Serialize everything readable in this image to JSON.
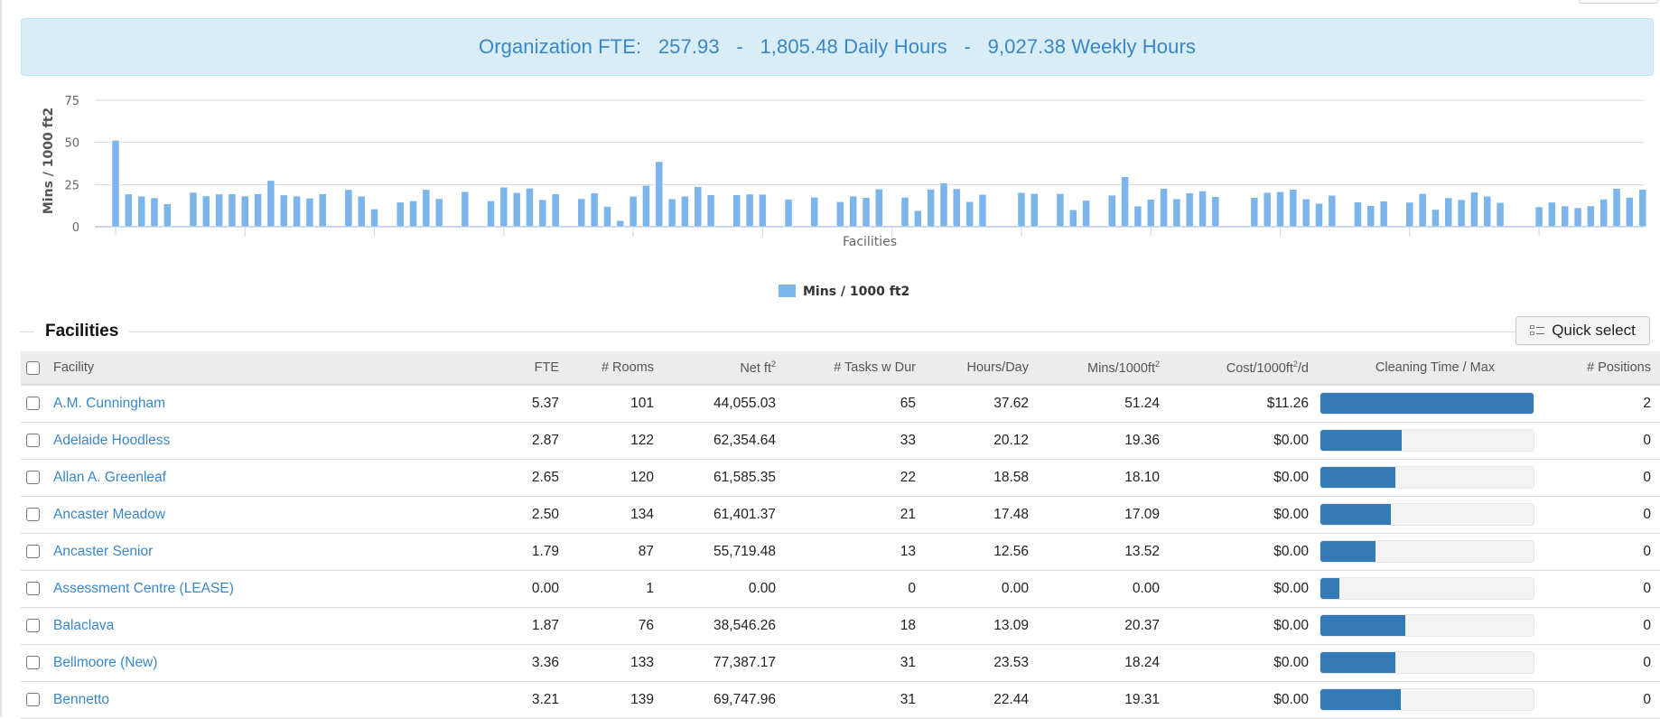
{
  "banner": {
    "label": "Organization FTE:",
    "fte": "257.93",
    "sep1": "-",
    "daily": "1,805.48 Daily Hours",
    "sep2": "-",
    "weekly": "9,027.38 Weekly Hours"
  },
  "chart_data": {
    "type": "bar",
    "title": "",
    "xlabel": "Facilities",
    "ylabel": "Mins / 1000 ft2",
    "ylim": [
      0,
      75
    ],
    "yticks": [
      0,
      25,
      50,
      75
    ],
    "grid": true,
    "legend": {
      "position": "bottom-center",
      "entries": [
        "Mins / 1000 ft2"
      ]
    },
    "series": [
      {
        "name": "Mins / 1000 ft2",
        "color": "#7cb5ec",
        "values": [
          51.24,
          19.36,
          18.1,
          17.09,
          13.52,
          0,
          20.37,
          18.24,
          19.31,
          19.4,
          18.2,
          19.5,
          27.4,
          18.8,
          18.1,
          16.9,
          19.5,
          0,
          22,
          18.1,
          10.5,
          0,
          14.5,
          15.3,
          22,
          16.6,
          0,
          20.7,
          0,
          15.3,
          23.4,
          20.2,
          22.8,
          16,
          19.4,
          0,
          16.6,
          20,
          12,
          3.6,
          18,
          24.5,
          38.6,
          16.5,
          18,
          23.8,
          18.9,
          0,
          18.9,
          19.3,
          19.2,
          0,
          16.2,
          0,
          17.5,
          0,
          14.8,
          18.1,
          17.3,
          22.3,
          0,
          17.4,
          9.5,
          22.2,
          25.9,
          22.5,
          14.9,
          19.1,
          0,
          0,
          20.2,
          19.6,
          0,
          19.6,
          10,
          15.6,
          0,
          18.7,
          29.6,
          12.2,
          16.2,
          22.7,
          16.5,
          20,
          21.2,
          17.8,
          0,
          0,
          17.3,
          20.3,
          20.8,
          22.1,
          16.5,
          13.8,
          18.6,
          0,
          14.6,
          12.5,
          15.2,
          0,
          14.5,
          19.6,
          10.2,
          17.1,
          16,
          20.5,
          18,
          14.3,
          0,
          0,
          11.8,
          14.5,
          12.3,
          11.2,
          12.3,
          16.3,
          22.7,
          17.4,
          22.1
        ]
      }
    ]
  },
  "section": {
    "title": "Facilities",
    "quick_select": "Quick select"
  },
  "table": {
    "columns": {
      "facility": "Facility",
      "fte": "FTE",
      "rooms": "# Rooms",
      "net": "Net ft",
      "tasks": "# Tasks w Dur",
      "hours": "Hours/Day",
      "mins": "Mins/1000ft",
      "cost_a": "Cost/1000ft",
      "cost_b": "/d",
      "ctime": "Cleaning Time / Max",
      "positions": "# Positions",
      "sup": "2"
    },
    "rows": [
      {
        "facility": "A.M. Cunningham",
        "fte": "5.37",
        "rooms": "101",
        "net": "44,055.03",
        "tasks": "65",
        "hours": "37.62",
        "mins": "51.24",
        "cost": "$11.26",
        "ctime": 1.0,
        "positions": "2"
      },
      {
        "facility": "Adelaide Hoodless",
        "fte": "2.87",
        "rooms": "122",
        "net": "62,354.64",
        "tasks": "33",
        "hours": "20.12",
        "mins": "19.36",
        "cost": "$0.00",
        "ctime": 0.38,
        "positions": "0"
      },
      {
        "facility": "Allan A. Greenleaf",
        "fte": "2.65",
        "rooms": "120",
        "net": "61,585.35",
        "tasks": "22",
        "hours": "18.58",
        "mins": "18.10",
        "cost": "$0.00",
        "ctime": 0.35,
        "positions": "0"
      },
      {
        "facility": "Ancaster Meadow",
        "fte": "2.50",
        "rooms": "134",
        "net": "61,401.37",
        "tasks": "21",
        "hours": "17.48",
        "mins": "17.09",
        "cost": "$0.00",
        "ctime": 0.33,
        "positions": "0"
      },
      {
        "facility": "Ancaster Senior",
        "fte": "1.79",
        "rooms": "87",
        "net": "55,719.48",
        "tasks": "13",
        "hours": "12.56",
        "mins": "13.52",
        "cost": "$0.00",
        "ctime": 0.26,
        "positions": "0"
      },
      {
        "facility": "Assessment Centre (LEASE)",
        "fte": "0.00",
        "rooms": "1",
        "net": "0.00",
        "tasks": "0",
        "hours": "0.00",
        "mins": "0.00",
        "cost": "$0.00",
        "ctime": 0.09,
        "positions": "0"
      },
      {
        "facility": "Balaclava",
        "fte": "1.87",
        "rooms": "76",
        "net": "38,546.26",
        "tasks": "18",
        "hours": "13.09",
        "mins": "20.37",
        "cost": "$0.00",
        "ctime": 0.4,
        "positions": "0"
      },
      {
        "facility": "Bellmoore (New)",
        "fte": "3.36",
        "rooms": "133",
        "net": "77,387.17",
        "tasks": "31",
        "hours": "23.53",
        "mins": "18.24",
        "cost": "$0.00",
        "ctime": 0.35,
        "positions": "0"
      },
      {
        "facility": "Bennetto",
        "fte": "3.21",
        "rooms": "139",
        "net": "69,747.96",
        "tasks": "31",
        "hours": "22.44",
        "mins": "19.31",
        "cost": "$0.00",
        "ctime": 0.375,
        "positions": "0"
      }
    ]
  }
}
